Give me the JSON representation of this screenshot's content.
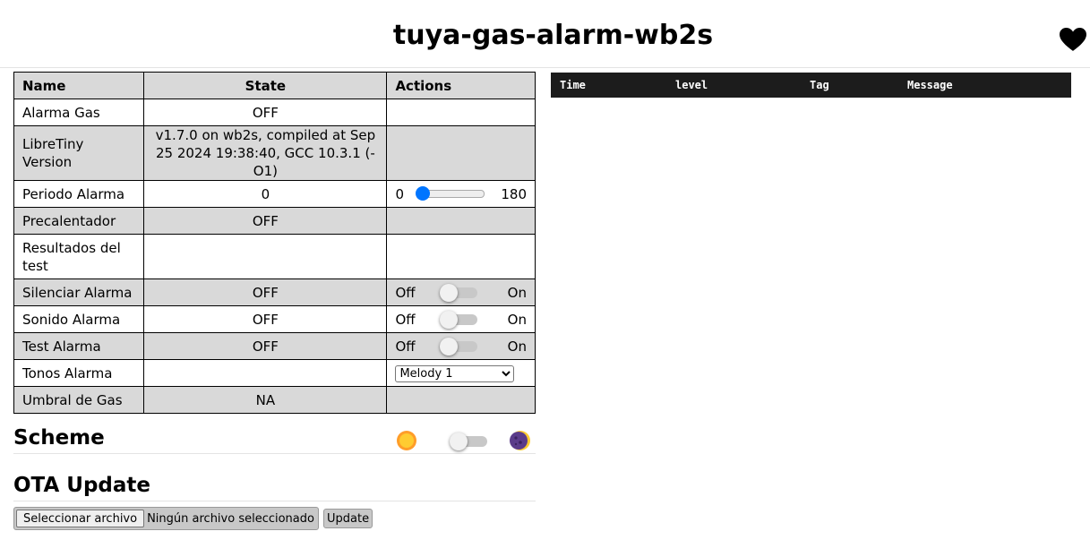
{
  "header": {
    "title": "tuya-gas-alarm-wb2s",
    "heart_icon": "heart-icon"
  },
  "entities": {
    "columns": [
      "Name",
      "State",
      "Actions"
    ],
    "rows": [
      {
        "name": "Alarma Gas",
        "state": "OFF"
      },
      {
        "name": "LibreTiny Version",
        "state": "v1.7.0 on wb2s, compiled at Sep 25 2024 19:38:40, GCC 10.3.1 (-O1)"
      },
      {
        "name": "Periodo Alarma",
        "state": "0",
        "slider": {
          "min": "0",
          "max": "180",
          "value": 0
        }
      },
      {
        "name": "Precalentador",
        "state": "OFF"
      },
      {
        "name": "Resultados del test",
        "state": ""
      },
      {
        "name": "Silenciar Alarma",
        "state": "OFF",
        "switch": {
          "off": "Off",
          "on": "On",
          "checked": false
        }
      },
      {
        "name": "Sonido Alarma",
        "state": "OFF",
        "switch": {
          "off": "Off",
          "on": "On",
          "checked": false
        }
      },
      {
        "name": "Test Alarma",
        "state": "OFF",
        "switch": {
          "off": "Off",
          "on": "On",
          "checked": false
        }
      },
      {
        "name": "Tonos Alarma",
        "state": "",
        "select": {
          "value": "Melody 1"
        }
      },
      {
        "name": "Umbral de Gas",
        "state": "NA"
      }
    ]
  },
  "scheme": {
    "title": "Scheme",
    "light_icon": "sun-icon",
    "dark_icon": "moon-icon",
    "dark_enabled": false
  },
  "ota": {
    "title": "OTA Update",
    "file_button": "Seleccionar archivo",
    "file_status": "Ningún archivo seleccionado",
    "update_button": "Update"
  },
  "log": {
    "columns": [
      "Time",
      "level",
      "Tag",
      "Message"
    ]
  },
  "colors": {
    "accent": "#0075ff",
    "row_alt": "#d9d9d9",
    "log_bg": "#1c1c1c"
  }
}
